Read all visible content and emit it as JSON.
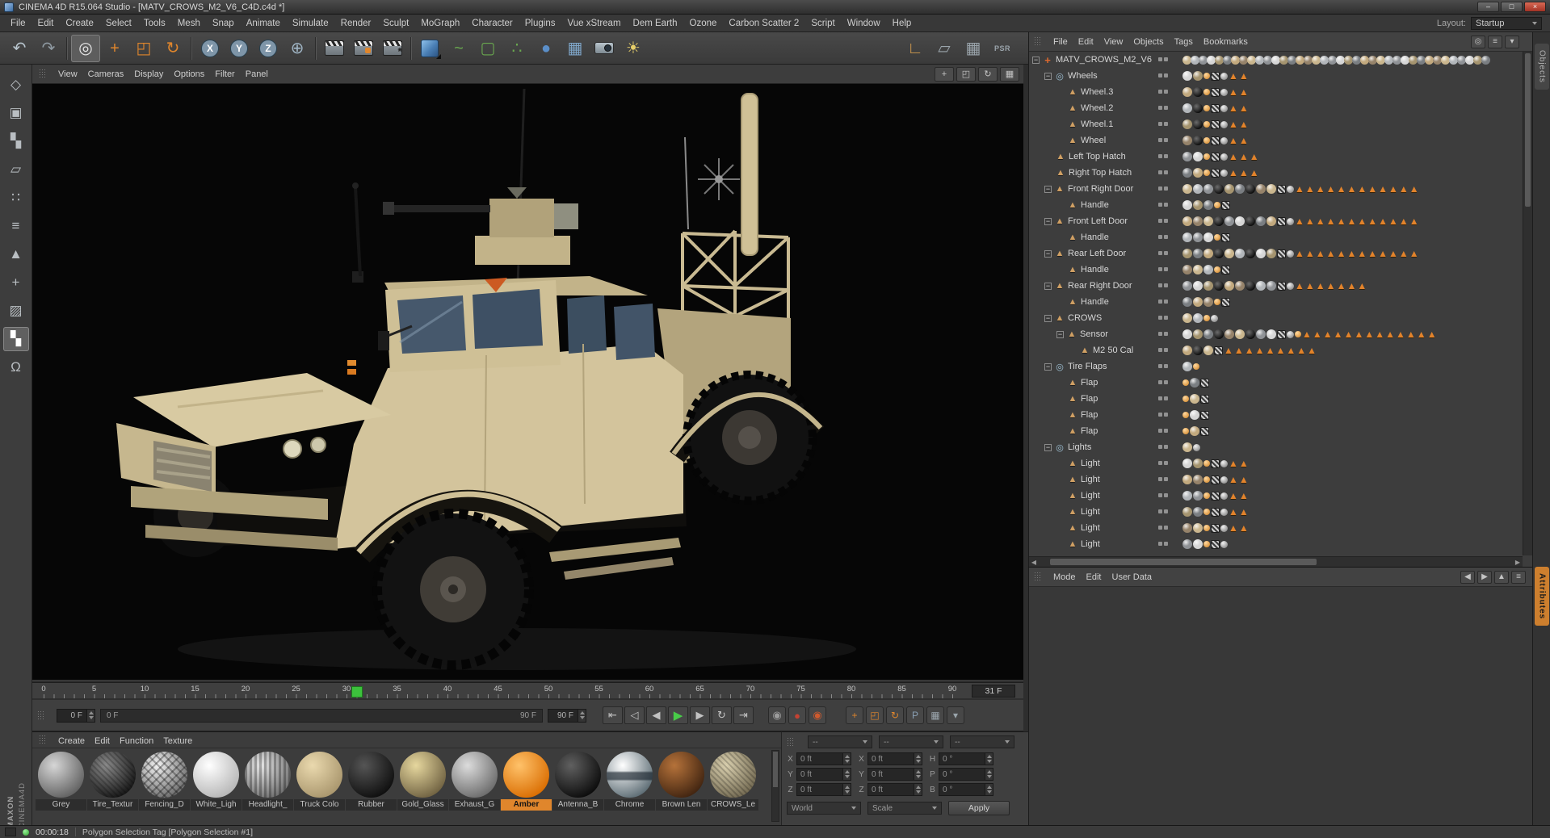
{
  "window": {
    "title": "CINEMA 4D R15.064 Studio - [MATV_CROWS_M2_V6_C4D.c4d *]",
    "controls": [
      {
        "name": "minimize",
        "glyph": "–"
      },
      {
        "name": "maximize",
        "glyph": "□"
      },
      {
        "name": "close",
        "glyph": "×"
      }
    ]
  },
  "menubar": {
    "items": [
      "File",
      "Edit",
      "Create",
      "Select",
      "Tools",
      "Mesh",
      "Snap",
      "Animate",
      "Simulate",
      "Render",
      "Sculpt",
      "MoGraph",
      "Character",
      "Plugins",
      "Vue xStream",
      "Dem Earth",
      "Ozone",
      "Carbon Scatter 2",
      "Script",
      "Window",
      "Help"
    ],
    "layout_label": "Layout:",
    "layout_value": "Startup"
  },
  "toolbar": {
    "buttons": [
      {
        "name": "undo",
        "glyph": "↶",
        "color": "#b9c6cf"
      },
      {
        "name": "redo",
        "glyph": "↷",
        "color": "#8f9aa2"
      },
      {
        "sep": true
      },
      {
        "name": "live-selection",
        "glyph": "◎",
        "color": "#e8e8e8",
        "selected": true
      },
      {
        "name": "move-tool",
        "glyph": "+",
        "color": "#e0862c"
      },
      {
        "name": "scale-tool",
        "glyph": "◰",
        "color": "#e0862c"
      },
      {
        "name": "rotate-tool",
        "glyph": "↻",
        "color": "#e0862c"
      },
      {
        "sep": true
      },
      {
        "name": "lock-x-axis",
        "glyph": "X",
        "circle": "#7e95a8"
      },
      {
        "name": "lock-y-axis",
        "glyph": "Y",
        "circle": "#7e95a8"
      },
      {
        "name": "lock-z-axis",
        "glyph": "Z",
        "circle": "#7e95a8"
      },
      {
        "name": "coordinate-system",
        "glyph": "⊕",
        "color": "#9fb4c4"
      },
      {
        "sep": true
      },
      {
        "name": "render-view",
        "clapper": true
      },
      {
        "name": "render-picture-viewer",
        "clapper": true,
        "dot": "#e0862c"
      },
      {
        "name": "render-settings",
        "clapper": true,
        "gear": true
      },
      {
        "sep": true
      },
      {
        "name": "add-primitive-cube",
        "cube": true
      },
      {
        "name": "add-spline",
        "glyph": "~",
        "color": "#69a84f"
      },
      {
        "name": "add-generator",
        "glyph": "▢",
        "color": "#69a84f"
      },
      {
        "name": "add-mograph",
        "glyph": "∴",
        "color": "#69a84f"
      },
      {
        "name": "add-deformer",
        "glyph": "●",
        "color": "#5b8fc9"
      },
      {
        "name": "add-environment",
        "glyph": "▦",
        "color": "#7fa6c9"
      },
      {
        "name": "add-camera",
        "camera": true
      },
      {
        "name": "add-light",
        "glyph": "☀",
        "color": "#e8d06a"
      }
    ],
    "right_buttons": [
      {
        "name": "world-axes",
        "glyph": "∟",
        "color": "#d09a4e"
      },
      {
        "name": "viewport-filter",
        "glyph": "▱",
        "color": "#9aa4ab"
      },
      {
        "name": "workplane",
        "glyph": "▦",
        "color": "#9aa4ab"
      },
      {
        "name": "psr-snap",
        "glyph": "PSR",
        "color": "#9aa4ab",
        "text": true
      }
    ]
  },
  "left_toolbar": {
    "buttons": [
      {
        "name": "make-editable",
        "glyph": "◇"
      },
      {
        "name": "model-mode",
        "glyph": "▣"
      },
      {
        "name": "texture-mode",
        "glyph": "▚"
      },
      {
        "name": "workplane-mode",
        "glyph": "▱"
      },
      {
        "name": "points-mode",
        "glyph": "∷"
      },
      {
        "name": "edges-mode",
        "glyph": "≡"
      },
      {
        "name": "polygons-mode",
        "glyph": "▲"
      },
      {
        "name": "axis-mode",
        "glyph": "+"
      },
      {
        "name": "uv-mode",
        "glyph": "▨"
      },
      {
        "name": "texture-paint-mode",
        "glyph": "▚",
        "selected": true
      },
      {
        "name": "snap-mode",
        "glyph": "Ω"
      }
    ]
  },
  "viewport": {
    "menu": [
      "View",
      "Cameras",
      "Display",
      "Options",
      "Filter",
      "Panel"
    ],
    "corner_buttons": [
      {
        "name": "pan-view",
        "glyph": "+"
      },
      {
        "name": "zoom-view",
        "glyph": "◰"
      },
      {
        "name": "rotate-view",
        "glyph": "↻"
      },
      {
        "name": "switch-view",
        "glyph": "▦"
      }
    ]
  },
  "timeline": {
    "tick_labels": [
      "0",
      "5",
      "10",
      "15",
      "20",
      "25",
      "30",
      "35",
      "40",
      "45",
      "50",
      "55",
      "60",
      "65",
      "70",
      "75",
      "80",
      "85",
      "90"
    ],
    "frame_max": 90,
    "current_frame": 31,
    "current_frame_field": "31 F",
    "range_start": "0 F",
    "range_end": "90 F",
    "end_field": "90 F",
    "transport_buttons": [
      {
        "name": "goto-start",
        "glyph": "⇤"
      },
      {
        "name": "previous-key",
        "glyph": "◁"
      },
      {
        "name": "previous-frame",
        "glyph": "◀"
      },
      {
        "name": "play",
        "glyph": "▶",
        "green": true
      },
      {
        "name": "next-frame",
        "glyph": "▶"
      },
      {
        "name": "play-loop",
        "glyph": "↻"
      },
      {
        "name": "goto-end",
        "glyph": "⇥"
      }
    ],
    "record_buttons": [
      {
        "name": "record-active-objects",
        "glyph": "◉",
        "color": "#9c9c9c"
      },
      {
        "name": "autokeying",
        "glyph": "●",
        "color": "#c44232"
      },
      {
        "name": "keyframe-selection",
        "glyph": "◉",
        "color": "#cf5a2e"
      }
    ],
    "record_toggles": [
      {
        "name": "record-position",
        "glyph": "+",
        "color": "#e0862c"
      },
      {
        "name": "record-scale",
        "glyph": "◰",
        "color": "#e0862c"
      },
      {
        "name": "record-rotation",
        "glyph": "↻",
        "color": "#e0862c"
      },
      {
        "name": "record-parameter",
        "glyph": "P",
        "color": "#8aa0b4"
      },
      {
        "name": "record-pla",
        "glyph": "▦",
        "color": "#9aa4ab"
      },
      {
        "name": "keyframe-presets",
        "glyph": "▾",
        "color": "#9aa4ab"
      }
    ]
  },
  "materials": {
    "menu": [
      "Create",
      "Edit",
      "Function",
      "Texture"
    ],
    "items": [
      {
        "name": "Grey",
        "c1": "#d6d6d6",
        "c2": "#5f5f5f"
      },
      {
        "name": "Tire_Textur",
        "c1": "#8a8a8a",
        "c2": "#141414",
        "pattern": "noise"
      },
      {
        "name": "Fencing_D",
        "c1": "#f2f2f2",
        "c2": "#6a6a6a",
        "pattern": "cross"
      },
      {
        "name": "White_Ligh",
        "c1": "#ffffff",
        "c2": "#b5b5b5"
      },
      {
        "name": "Headlight_",
        "c1": "#e5e5e5",
        "c2": "#6e6e6e",
        "pattern": "stripes"
      },
      {
        "name": "Truck Colo",
        "c1": "#ead9ae",
        "c2": "#a8956c"
      },
      {
        "name": "Rubber",
        "c1": "#555555",
        "c2": "#0d0d0d"
      },
      {
        "name": "Gold_Glass",
        "c1": "#e6d79e",
        "c2": "#6e6040"
      },
      {
        "name": "Exhaust_G",
        "c1": "#dcdcdc",
        "c2": "#6a6a6a"
      },
      {
        "name": "Amber",
        "c1": "#ffc26a",
        "c2": "#d96c00",
        "selected": true
      },
      {
        "name": "Antenna_B",
        "c1": "#606060",
        "c2": "#0a0a0a"
      },
      {
        "name": "Chrome",
        "c1": "#ffffff",
        "c2": "#5a6a72",
        "pattern": "chrome"
      },
      {
        "name": "Brown Len",
        "c1": "#b5723a",
        "c2": "#3f2310"
      },
      {
        "name": "CROWS_Le",
        "c1": "#d9cfae",
        "c2": "#736a52",
        "pattern": "noise"
      }
    ]
  },
  "coordinates": {
    "headers": [
      "--",
      "--",
      "--"
    ],
    "rows": [
      {
        "cells": [
          {
            "label": "X",
            "value": "0 ft"
          },
          {
            "label": "X",
            "value": "0 ft"
          },
          {
            "label": "H",
            "value": "0 °"
          }
        ]
      },
      {
        "cells": [
          {
            "label": "Y",
            "value": "0 ft"
          },
          {
            "label": "Y",
            "value": "0 ft"
          },
          {
            "label": "P",
            "value": "0 °"
          }
        ]
      },
      {
        "cells": [
          {
            "label": "Z",
            "value": "0 ft"
          },
          {
            "label": "Z",
            "value": "0 ft"
          },
          {
            "label": "B",
            "value": "0 °"
          }
        ]
      }
    ],
    "world": "World",
    "scale": "Scale",
    "apply": "Apply"
  },
  "object_manager": {
    "menu": [
      "File",
      "Edit",
      "View",
      "Objects",
      "Tags",
      "Bookmarks"
    ],
    "header_icons": [
      {
        "name": "search",
        "glyph": "◎"
      },
      {
        "name": "filter",
        "glyph": "≡"
      },
      {
        "name": "panel-options",
        "glyph": "▾"
      }
    ],
    "tree": [
      {
        "label": "MATV_CROWS_M2_V6",
        "level": 0,
        "icon": "axis",
        "exp": true,
        "dense": true,
        "tags": "ssssssssssssssssssssssssssssssssssssss"
      },
      {
        "label": "Wheels",
        "level": 1,
        "icon": "null",
        "exp": true,
        "tags": "ssucptt"
      },
      {
        "label": "Wheel.3",
        "level": 2,
        "icon": "poly",
        "tags": "sducptt"
      },
      {
        "label": "Wheel.2",
        "level": 2,
        "icon": "poly",
        "tags": "sducptt"
      },
      {
        "label": "Wheel.1",
        "level": 2,
        "icon": "poly",
        "tags": "sducptt"
      },
      {
        "label": "Wheel",
        "level": 2,
        "icon": "poly",
        "tags": "sducptt"
      },
      {
        "label": "Left Top Hatch",
        "level": 1,
        "icon": "poly",
        "tags": "ssucpttt"
      },
      {
        "label": "Right Top Hatch",
        "level": 1,
        "icon": "poly",
        "tags": "ssucpttt"
      },
      {
        "label": "Front Right Door",
        "level": 1,
        "icon": "poly",
        "exp": true,
        "tags": "sssdssdsscptttttttttttt"
      },
      {
        "label": "Handle",
        "level": 2,
        "icon": "poly",
        "tags": "sssuc"
      },
      {
        "label": "Front Left Door",
        "level": 1,
        "icon": "poly",
        "exp": true,
        "tags": "sssdssdsscptttttttttttt"
      },
      {
        "label": "Handle",
        "level": 2,
        "icon": "poly",
        "tags": "sssuc"
      },
      {
        "label": "Rear Left Door",
        "level": 1,
        "icon": "poly",
        "exp": true,
        "tags": "sssdssdsscptttttttttttt"
      },
      {
        "label": "Handle",
        "level": 2,
        "icon": "poly",
        "tags": "sssuc"
      },
      {
        "label": "Rear Right Door",
        "level": 1,
        "icon": "poly",
        "exp": true,
        "tags": "sssdssdsscpttttttt"
      },
      {
        "label": "Handle",
        "level": 2,
        "icon": "poly",
        "tags": "sssuc"
      },
      {
        "label": "CROWS",
        "level": 1,
        "icon": "poly",
        "exp": true,
        "tags": "ssup"
      },
      {
        "label": "Sensor",
        "level": 2,
        "icon": "poly",
        "exp": true,
        "tags": "sssdssdsscputtttttttttttt"
      },
      {
        "label": "M2 50 Cal",
        "level": 3,
        "icon": "poly",
        "tags": "sdscttttttttt"
      },
      {
        "label": "Tire Flaps",
        "level": 1,
        "icon": "null",
        "exp": true,
        "tags": "su"
      },
      {
        "label": "Flap",
        "level": 2,
        "icon": "poly",
        "tags": "usc"
      },
      {
        "label": "Flap",
        "level": 2,
        "icon": "poly",
        "tags": "usc"
      },
      {
        "label": "Flap",
        "level": 2,
        "icon": "poly",
        "tags": "usc"
      },
      {
        "label": "Flap",
        "level": 2,
        "icon": "poly",
        "tags": "usc"
      },
      {
        "label": "Lights",
        "level": 1,
        "icon": "null",
        "exp": true,
        "tags": "sp"
      },
      {
        "label": "Light",
        "level": 2,
        "icon": "poly",
        "tags": "ssucptt"
      },
      {
        "label": "Light",
        "level": 2,
        "icon": "poly",
        "tags": "ssucptt"
      },
      {
        "label": "Light",
        "level": 2,
        "icon": "poly",
        "tags": "ssucptt"
      },
      {
        "label": "Light",
        "level": 2,
        "icon": "poly",
        "tags": "ssucptt"
      },
      {
        "label": "Light",
        "level": 2,
        "icon": "poly",
        "tags": "ssucptt"
      },
      {
        "label": "Light",
        "level": 2,
        "icon": "poly",
        "tags": "ssucp"
      }
    ]
  },
  "attributes": {
    "menu": [
      "Mode",
      "Edit",
      "User Data"
    ],
    "header_icons": [
      {
        "name": "history-back",
        "glyph": "◀"
      },
      {
        "name": "history-forward",
        "glyph": "▶"
      },
      {
        "name": "parent-object",
        "glyph": "▲"
      },
      {
        "name": "panel-menu",
        "glyph": "≡"
      }
    ]
  },
  "right_edge": {
    "tabs": [
      {
        "label": "Objects",
        "active": false
      },
      {
        "label": "Attributes",
        "active": true
      }
    ]
  },
  "statusbar": {
    "time": "00:00:18",
    "message": "Polygon Selection Tag [Polygon Selection #1]"
  },
  "branding": {
    "line1": "MAXON",
    "line2": "CINEMA4D"
  },
  "accent_colors": {
    "orange": "#e0862c",
    "green_marker": "#3cc13c",
    "tag_triangle": "#e2832b"
  }
}
